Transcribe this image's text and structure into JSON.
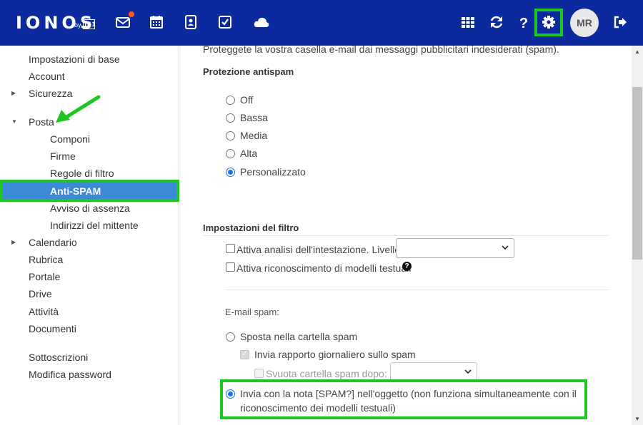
{
  "header": {
    "logo": "IONOS",
    "logo_by": "by",
    "logo_brand": "1&1",
    "avatar_initials": "MR",
    "icons": [
      "mail-icon",
      "calendar-icon",
      "contacts-icon",
      "tasks-icon",
      "cloud-icon",
      "apps-grid-icon",
      "refresh-icon",
      "help-icon",
      "settings-gear-icon",
      "logout-icon"
    ],
    "accent_color": "#0b2a9e",
    "highlight_color": "#1fc61f"
  },
  "sidebar": {
    "items": [
      {
        "label": "Impostazioni di base"
      },
      {
        "label": "Account"
      },
      {
        "label": "Sicurezza"
      },
      {
        "label": "Posta"
      },
      {
        "label": "Componi"
      },
      {
        "label": "Firme"
      },
      {
        "label": "Regole di filtro"
      },
      {
        "label": "Anti-SPAM"
      },
      {
        "label": "Avviso di assenza"
      },
      {
        "label": "Indirizzi del mittente"
      },
      {
        "label": "Calendario"
      },
      {
        "label": "Rubrica"
      },
      {
        "label": "Portale"
      },
      {
        "label": "Drive"
      },
      {
        "label": "Attività"
      },
      {
        "label": "Documenti"
      },
      {
        "label": "Sottoscrizioni"
      },
      {
        "label": "Modifica password"
      }
    ]
  },
  "main": {
    "intro": "Proteggete la vostra casella e-mail dai messaggi pubblicitari indesiderati (spam).",
    "antispam_title": "Protezione antispam",
    "antispam_options": [
      "Off",
      "Bassa",
      "Media",
      "Alta",
      "Personalizzato"
    ],
    "antispam_selected": "Personalizzato",
    "filter_title": "Impostazioni del filtro",
    "header_analysis": "Attiva analisi dell'intestazione. Livello:",
    "pattern_recognition": "Attiva riconoscimento di modelli testuali",
    "spam_email_label": "E-mail spam:",
    "move_to_spam": "Sposta nella cartella spam",
    "daily_report": "Invia rapporto giornaliero sullo spam",
    "empty_spam": "Svuota cartella spam dopo:",
    "send_with_note_line1": "Invia con la nota [SPAM?] nell'oggetto (non funziona simultaneamente con il",
    "send_with_note_line2": "riconoscimento dei modelli testuali)"
  }
}
